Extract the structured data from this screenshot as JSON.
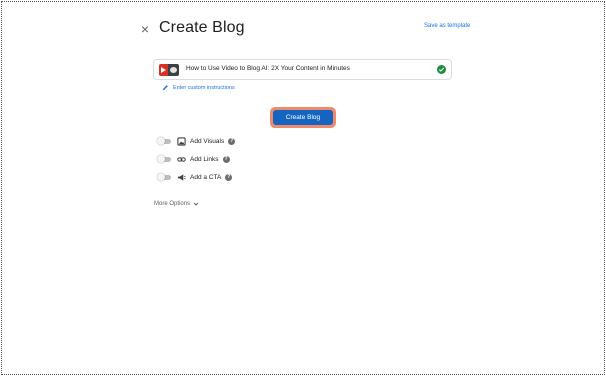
{
  "header": {
    "close_glyph": "×",
    "title": "Create Blog",
    "save_template": "Save as template"
  },
  "topic": {
    "text": "How to Use Video to Blog AI: 2X Your Content in Minutes",
    "status_icon": "check-circle-icon",
    "status_color": "#1e8e3e"
  },
  "custom_instructions": {
    "label": "Enter custom instructions",
    "icon": "pencil-icon"
  },
  "primary_button": {
    "label": "Create Blog",
    "color": "#1565c0",
    "focus_ring": "#f08a6c"
  },
  "options": [
    {
      "label": "Add Visuals",
      "icon": "image-icon",
      "enabled": false,
      "help": "?"
    },
    {
      "label": "Add Links",
      "icon": "link-icon",
      "enabled": false,
      "help": "?"
    },
    {
      "label": "Add a CTA",
      "icon": "megaphone-icon",
      "enabled": false,
      "help": "?"
    }
  ],
  "more_options": {
    "label": "More Options",
    "icon": "chevron-down-icon"
  },
  "accent_color": "#1a73e8"
}
